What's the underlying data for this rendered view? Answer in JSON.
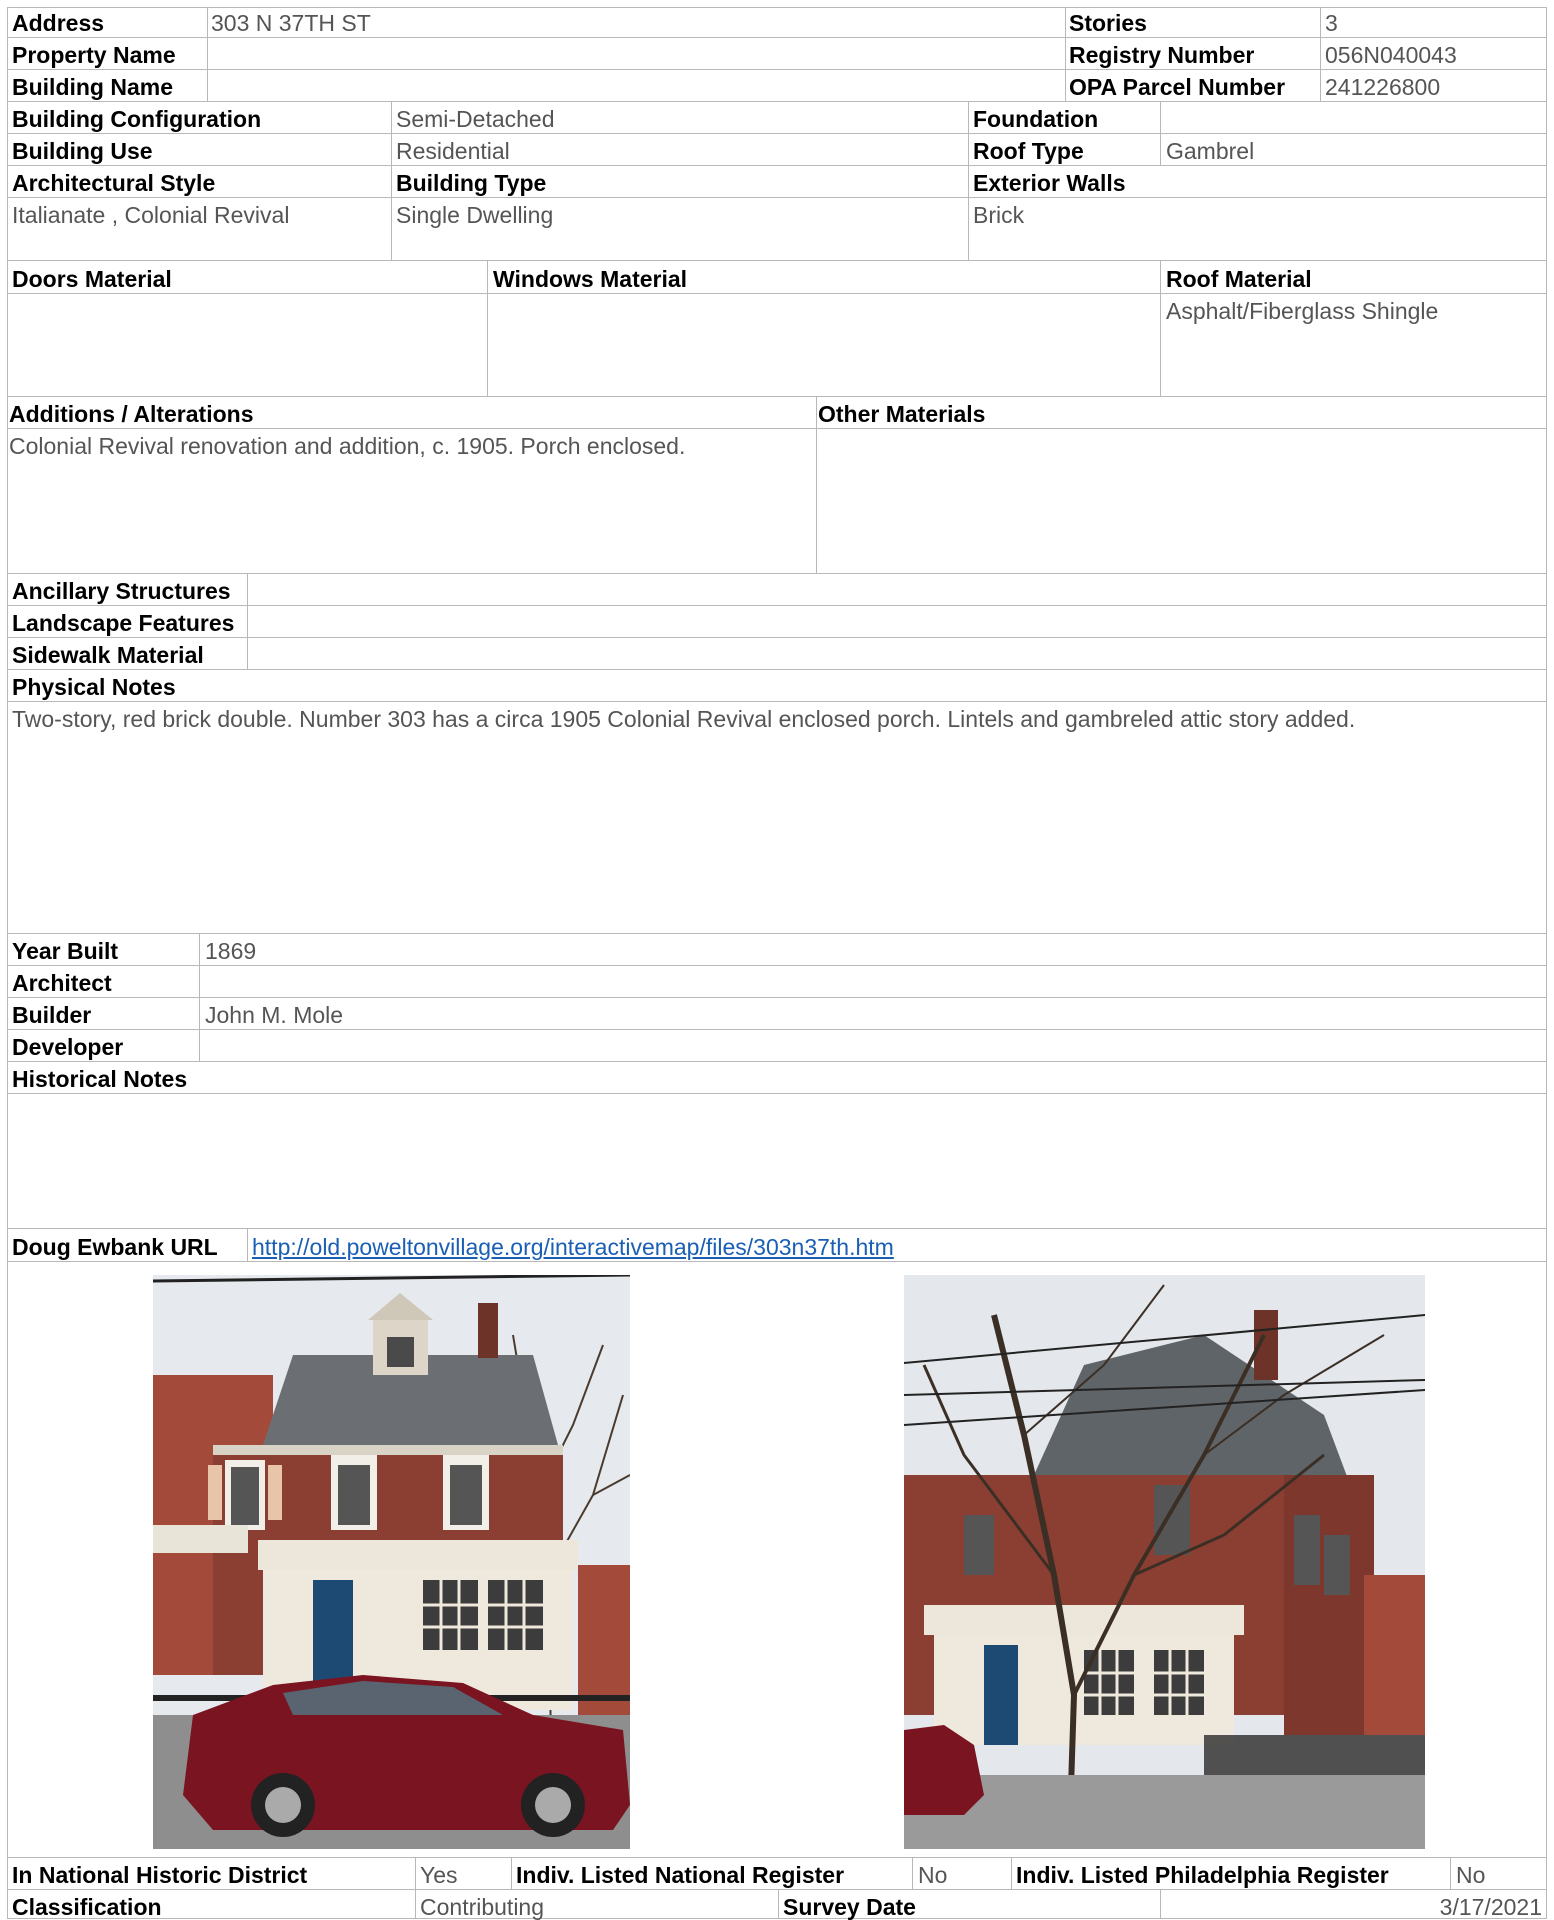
{
  "address": {
    "label": "Address",
    "value": "303 N 37TH ST"
  },
  "stories": {
    "label": "Stories",
    "value": "3"
  },
  "property_name": {
    "label": "Property Name",
    "value": ""
  },
  "registry_number": {
    "label": "Registry Number",
    "value": "056N040043"
  },
  "building_name": {
    "label": "Building Name",
    "value": ""
  },
  "opa_parcel_number": {
    "label": "OPA Parcel Number",
    "value": "241226800"
  },
  "building_configuration": {
    "label": "Building Configuration",
    "value": "Semi-Detached"
  },
  "foundation": {
    "label": "Foundation",
    "value": ""
  },
  "building_use": {
    "label": "Building Use",
    "value": "Residential"
  },
  "roof_type": {
    "label": "Roof Type",
    "value": "Gambrel"
  },
  "architectural_style": {
    "label": "Architectural Style",
    "value": "Italianate , Colonial Revival"
  },
  "building_type": {
    "label": "Building Type",
    "value": "Single Dwelling"
  },
  "exterior_walls": {
    "label": "Exterior Walls",
    "value": "Brick"
  },
  "doors_material": {
    "label": "Doors Material",
    "value": ""
  },
  "windows_material": {
    "label": "Windows Material",
    "value": ""
  },
  "roof_material": {
    "label": "Roof Material",
    "value": "Asphalt/Fiberglass Shingle"
  },
  "additions_alterations": {
    "label": "Additions / Alterations",
    "value": "Colonial Revival renovation and addition, c. 1905. Porch enclosed."
  },
  "other_materials": {
    "label": "Other Materials",
    "value": ""
  },
  "ancillary_structures": {
    "label": "Ancillary Structures",
    "value": ""
  },
  "landscape_features": {
    "label": "Landscape Features",
    "value": ""
  },
  "sidewalk_material": {
    "label": "Sidewalk Material",
    "value": ""
  },
  "physical_notes": {
    "label": "Physical Notes",
    "value": "Two-story, red brick double. Number 303 has a circa 1905 Colonial Revival enclosed porch. Lintels and gambreled attic story added."
  },
  "year_built": {
    "label": "Year Built",
    "value": "1869"
  },
  "architect": {
    "label": "Architect",
    "value": ""
  },
  "builder": {
    "label": "Builder",
    "value": "John M. Mole"
  },
  "developer": {
    "label": "Developer",
    "value": ""
  },
  "historical_notes": {
    "label": "Historical Notes",
    "value": ""
  },
  "doug_ewbank_url": {
    "label": "Doug Ewbank URL",
    "value": "http://old.poweltonvillage.org/interactivemap/files/303n37th.htm"
  },
  "national_historic_district": {
    "label": "In National Historic District",
    "value": "Yes"
  },
  "indiv_national_register": {
    "label": "Indiv. Listed National Register",
    "value": "No"
  },
  "indiv_philadelphia_register": {
    "label": "Indiv. Listed Philadelphia Register",
    "value": "No"
  },
  "classification": {
    "label": "Classification",
    "value": "Contributing"
  },
  "survey_date": {
    "label": "Survey Date",
    "value": "3/17/2021"
  },
  "colors": {
    "border": "#b8b8b8",
    "value_text": "#555555",
    "link": "#1a5fb4",
    "brick": "#8b3f33",
    "car": "#7a1420",
    "sky": "#e6e9ee"
  }
}
